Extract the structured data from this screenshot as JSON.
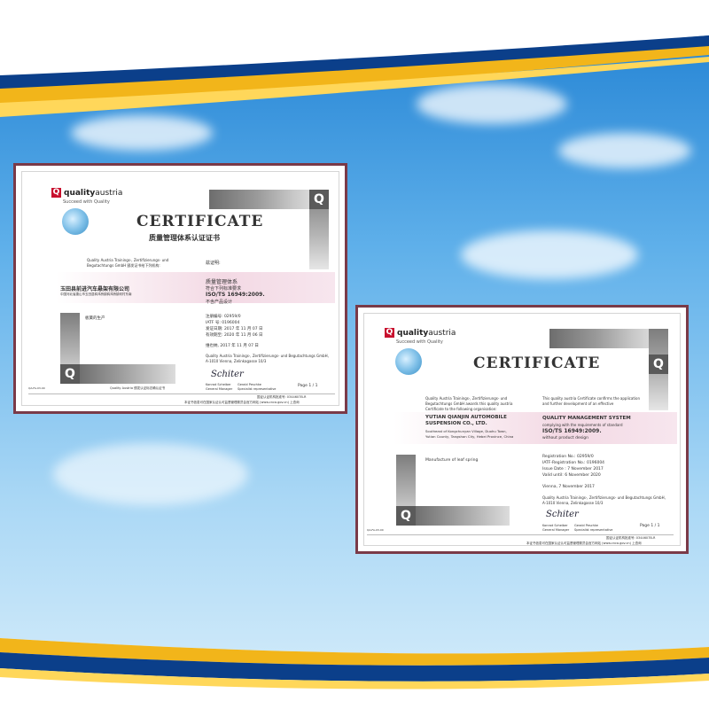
{
  "brand": {
    "logo_mark": "Q",
    "logo_bold": "quality",
    "logo_light": "austria",
    "tagline": "Succeed with Quality"
  },
  "cert_cn": {
    "title": "CERTIFICATE",
    "subtitle": "质量管理体系认证证书",
    "issuer_line1": "Quality Austria Trainings-, Zertifizierungs- und",
    "issuer_line2": "Begutachtungs GmbH 颁发证书给下列机构:",
    "attest_label": "兹证明:",
    "company": "玉田县前进汽车悬架有限公司",
    "address": "中国河北省唐山市玉田县鸦鸿桥镇鸦鸿桥镇何村东南",
    "system_line": "质量管理体系",
    "complies": "符合下列标准要求",
    "standard": "ISO/TS 16949:2009.",
    "exclusion": "不含产品设计",
    "scope": "板簧的生产",
    "reg_no": "注册编号: 02959/0",
    "iatf_no": "IATF 号: 0196004",
    "issue_date": "发证日期: 2017 年 11 月 07 日",
    "valid_until": "有效期至: 2020 年 11 月 06 日",
    "place_date": "维也纳, 2017 年 11 月 07 日",
    "address_issuer1": "Quality Austria Trainings-, Zertifizierungs- und Begutachtungs GmbH,",
    "address_issuer2": "A-1010 Vienna, Zelinkagasse 10/3",
    "sig1_name": "Konrad Scheiber",
    "sig1_role": "General Manager",
    "sig2_name": "Gerald Peschke",
    "sig2_role": "Specialist representative",
    "page": "Page 1 / 1",
    "footer_note": "Quality Austria 颁发认证标志确认证书",
    "footer_small": "QA-FA-03-00",
    "cnca_no": "国证认证机构批准号: 0344607B-R",
    "cnca_line": "本证书信息可在国家认证认可监督管理委员会官方网站 (www.cnca.gov.cn) 上查询"
  },
  "cert_en": {
    "title": "CERTIFICATE",
    "issuer_line1": "Quality Austria Trainings-, Zertifizierungs- und",
    "issuer_line2": "Begutachtungs GmbH awards this quality austria",
    "issuer_line3": "Certificate to the following organisation:",
    "confirm_line1": "This quality austria Certificate confirms the application",
    "confirm_line2": "and further development of an effective",
    "company1": "YUTIAN QIANJIN AUTOMOBILE",
    "company2": "SUSPENSION CO., LTD.",
    "addr1": "Southeast of Kongchunyan Village, Duohu Town,",
    "addr2": "Yutian County, Tangshan City, Hebei Province, China",
    "system": "QUALITY MANAGEMENT SYSTEM",
    "complies": "complying with the requirements of standard",
    "standard": "ISO/TS 16949:2009.",
    "exclusion": "without product design",
    "scope": "Manufacture of leaf spring",
    "reg_no": "Registration No.: 02959/0",
    "iatf_no": "IATF-Registration No.: 0196004",
    "issue_date": "Issue Date : 7 November 2017",
    "valid_until": "Valid until: 6 November 2020",
    "place_date": "Vienna, 7 November 2017",
    "address_issuer1": "Quality Austria Trainings-, Zertifizierungs- und Begutachtungs GmbH,",
    "address_issuer2": "A-1010 Vienna, Zelinkagasse 10/3",
    "sig1_name": "Konrad Scheiber",
    "sig1_role": "General Manager",
    "sig2_name": "Gerald Peschke",
    "sig2_role": "Specialist representative",
    "page": "Page 1 / 1",
    "footer_small": "QA-FA-03-00",
    "cnca_no": "国证认证机构批准号: 0344607B-R",
    "cnca_line": "本证书信息可在国家认证认可监督管理委员会官方网站 (www.cnca.gov.cn) 上查询"
  },
  "colors": {
    "frame": "#7a3a48",
    "sky_top": "#1e7fd2",
    "band_yellow": "#f2b51a",
    "band_blue": "#0b3f8a",
    "logo_red": "#c8102e"
  }
}
